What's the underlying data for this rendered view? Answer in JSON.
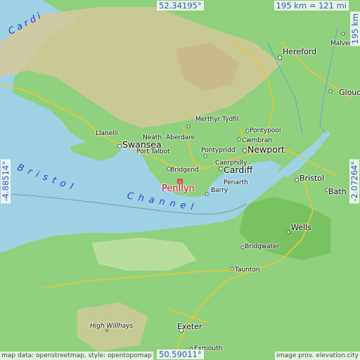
{
  "map": {
    "place": "Penllyn",
    "bounds": {
      "north": "52.34195°",
      "south": "50.59011°",
      "west": "-4.88514°",
      "east": "-2.07264°"
    },
    "scale_h": "195 km = 121 mi",
    "scale_v": "195 km",
    "water_labels": [
      "Bristol Channel",
      "Cardi"
    ],
    "places": [
      "Hereford",
      "Malvern",
      "Gloucester",
      "Merthyr Tydfil",
      "Pontypool",
      "Cwmbran",
      "Llanelli",
      "Neath",
      "Aberdare",
      "Swansea",
      "Port Talbot",
      "Pontypridd",
      "Newport",
      "Caerphilly",
      "Bridgend",
      "Cardiff",
      "Penarth",
      "Barry",
      "Bristol",
      "Bath",
      "Wells",
      "Bridgwater",
      "Taunton",
      "Exeter",
      "High Willhays",
      "Exmouth"
    ],
    "labels": {
      "hereford": "Hereford",
      "malvern": "Malvern",
      "glouc": "Glouc",
      "merthyr": "Merthyr Tydfil",
      "pontypool": "Pontypool",
      "cwmbran": "Cwmbran",
      "llanelli": "Llanelli",
      "neath": "Neath",
      "aberdare": "Aberdare",
      "swansea": "Swansea",
      "port_talbot": "Port Talbot",
      "pontypridd": "Pontypridd",
      "newport": "Newport",
      "caerphilly": "Caerphilly",
      "bridgend": "Bridgend",
      "cardiff": "Cardiff",
      "penarth": "Penarth",
      "barry": "Barry",
      "bristol": "Bristol",
      "bath": "Bath",
      "wells": "Wells",
      "bridgwater": "Bridgwater",
      "taunton": "Taunton",
      "exeter": "Exeter",
      "high_willhays": "High Willhays",
      "exmouth": "Exmouth",
      "cardi": "Cardi",
      "bristol_channel_1": "Bristol",
      "bristol_channel_2": "Channel"
    },
    "credits": {
      "left": "map data: openstreetmap, style: opentopomap",
      "right": "image prov. elevation.city"
    },
    "colors": {
      "sea": "#9ed3e8",
      "lowland": "#8fd17c",
      "upland": "#d6c99a",
      "road": "#e9c43a",
      "marker": "#c8102e",
      "coord_text": "#3355cc"
    }
  }
}
